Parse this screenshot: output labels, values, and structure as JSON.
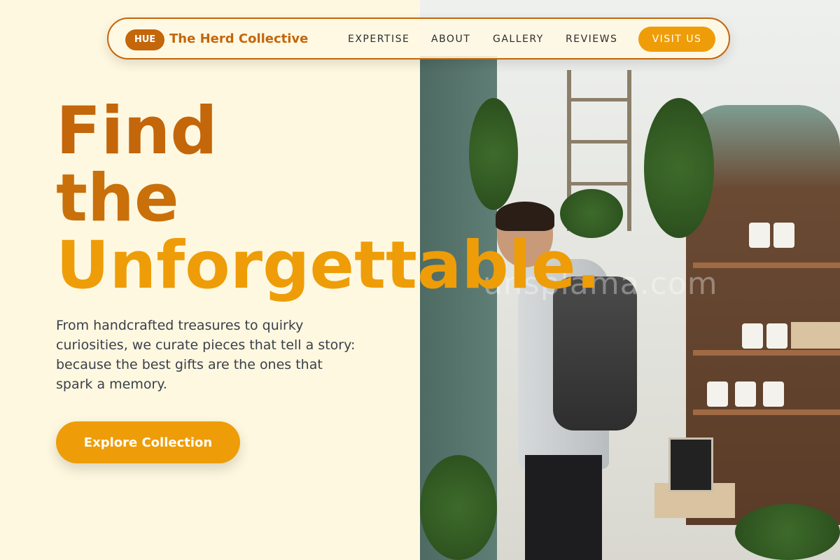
{
  "nav": {
    "logo_badge": "HUE",
    "brand": "The Herd Collective",
    "links": [
      "EXPERTISE",
      "ABOUT",
      "GALLERY",
      "REVIEWS"
    ],
    "cta": "VISIT US"
  },
  "hero": {
    "headline": [
      "Find",
      "the",
      "Unforgettable."
    ],
    "description": "From handcrafted treasures to quirky curiosities, we curate pieces that tell a story: because the best gifts are the ones that spark a memory.",
    "cta": "Explore Collection"
  },
  "photo": {
    "watermark": "unsplama.com"
  },
  "colors": {
    "background": "#fef8e0",
    "brand_dark": "#c4660a",
    "accent": "#ee9d08",
    "text": "#3a3f4b"
  }
}
